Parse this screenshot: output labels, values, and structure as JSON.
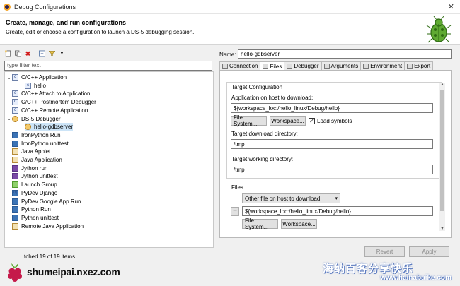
{
  "window": {
    "title": "Debug Configurations",
    "close": "✕"
  },
  "header": {
    "title": "Create, manage, and run configurations",
    "subtitle": "Create, edit or choose a configuration to launch a DS-5 debugging session."
  },
  "left": {
    "filter_placeholder": "type filter text",
    "status": "tched 19 of 19 items",
    "tree": [
      {
        "label": "C/C++ Application",
        "icon": "c-cpp-app-icon",
        "glyph": "c",
        "level": 0,
        "expanded": true
      },
      {
        "label": "hello",
        "icon": "c-cpp-config-icon",
        "glyph": "c",
        "level": 1
      },
      {
        "label": "C/C++ Attach to Application",
        "icon": "c-attach-icon",
        "glyph": "c",
        "level": 0
      },
      {
        "label": "C/C++ Postmortem Debugger",
        "icon": "c-postmortem-icon",
        "glyph": "c",
        "level": 0
      },
      {
        "label": "C/C++ Remote Application",
        "icon": "c-remote-icon",
        "glyph": "c",
        "level": 0
      },
      {
        "label": "DS-5 Debugger",
        "icon": "ds5-icon",
        "glyph": "",
        "level": 0,
        "expanded": true
      },
      {
        "label": "hello-gdbserver",
        "icon": "ds5-config-icon",
        "glyph": "",
        "level": 1,
        "selected": true
      },
      {
        "label": "IronPython Run",
        "icon": "ironpython-run-icon",
        "glyph": "",
        "level": 0
      },
      {
        "label": "IronPython unittest",
        "icon": "ironpython-unittest-icon",
        "glyph": "",
        "level": 0
      },
      {
        "label": "Java Applet",
        "icon": "java-applet-icon",
        "glyph": "",
        "level": 0
      },
      {
        "label": "Java Application",
        "icon": "java-app-icon",
        "glyph": "",
        "level": 0
      },
      {
        "label": "Jython run",
        "icon": "jython-run-icon",
        "glyph": "",
        "level": 0
      },
      {
        "label": "Jython unittest",
        "icon": "jython-unittest-icon",
        "glyph": "",
        "level": 0
      },
      {
        "label": "Launch Group",
        "icon": "launch-group-icon",
        "glyph": "",
        "level": 0
      },
      {
        "label": "PyDev Django",
        "icon": "pydev-django-icon",
        "glyph": "dj",
        "level": 0
      },
      {
        "label": "PyDev Google App Run",
        "icon": "pydev-google-icon",
        "glyph": "",
        "level": 0
      },
      {
        "label": "Python Run",
        "icon": "python-run-icon",
        "glyph": "",
        "level": 0
      },
      {
        "label": "Python unittest",
        "icon": "python-unittest-icon",
        "glyph": "",
        "level": 0
      },
      {
        "label": "Remote Java Application",
        "icon": "remote-java-icon",
        "glyph": "",
        "level": 0
      }
    ]
  },
  "right": {
    "name_label": "Name:",
    "name_value": "hello-gdbserver",
    "tabs": [
      {
        "label": "Connection",
        "icon": "connection-icon"
      },
      {
        "label": "Files",
        "icon": "files-icon",
        "active": true
      },
      {
        "label": "Debugger",
        "icon": "debugger-icon"
      },
      {
        "label": "Arguments",
        "icon": "arguments-icon"
      },
      {
        "label": "Environment",
        "icon": "environment-icon"
      },
      {
        "label": "Export",
        "icon": "export-icon"
      }
    ],
    "target_group": "Target Configuration",
    "app_label": "Application on host to download:",
    "app_value": "${workspace_loc:/hello_linux/Debug/hello}",
    "file_system": "File System...",
    "workspace": "Workspace...",
    "load_symbols": "Load symbols",
    "download_dir_label": "Target download directory:",
    "download_dir_value": "/tmp",
    "working_dir_label": "Target working directory:",
    "working_dir_value": "/tmp",
    "files_group": "Files",
    "file_type": "Other file on host to download",
    "file_value": "${workspace_loc:/hello_linux/Debug/hello}",
    "minus": "−",
    "revert": "Revert",
    "apply": "Apply"
  },
  "watermark": {
    "left_text": "shumeipai.nxez.com",
    "right_text_cn": "海纳百客分享快乐",
    "right_url": "www.hainabaike.com"
  }
}
